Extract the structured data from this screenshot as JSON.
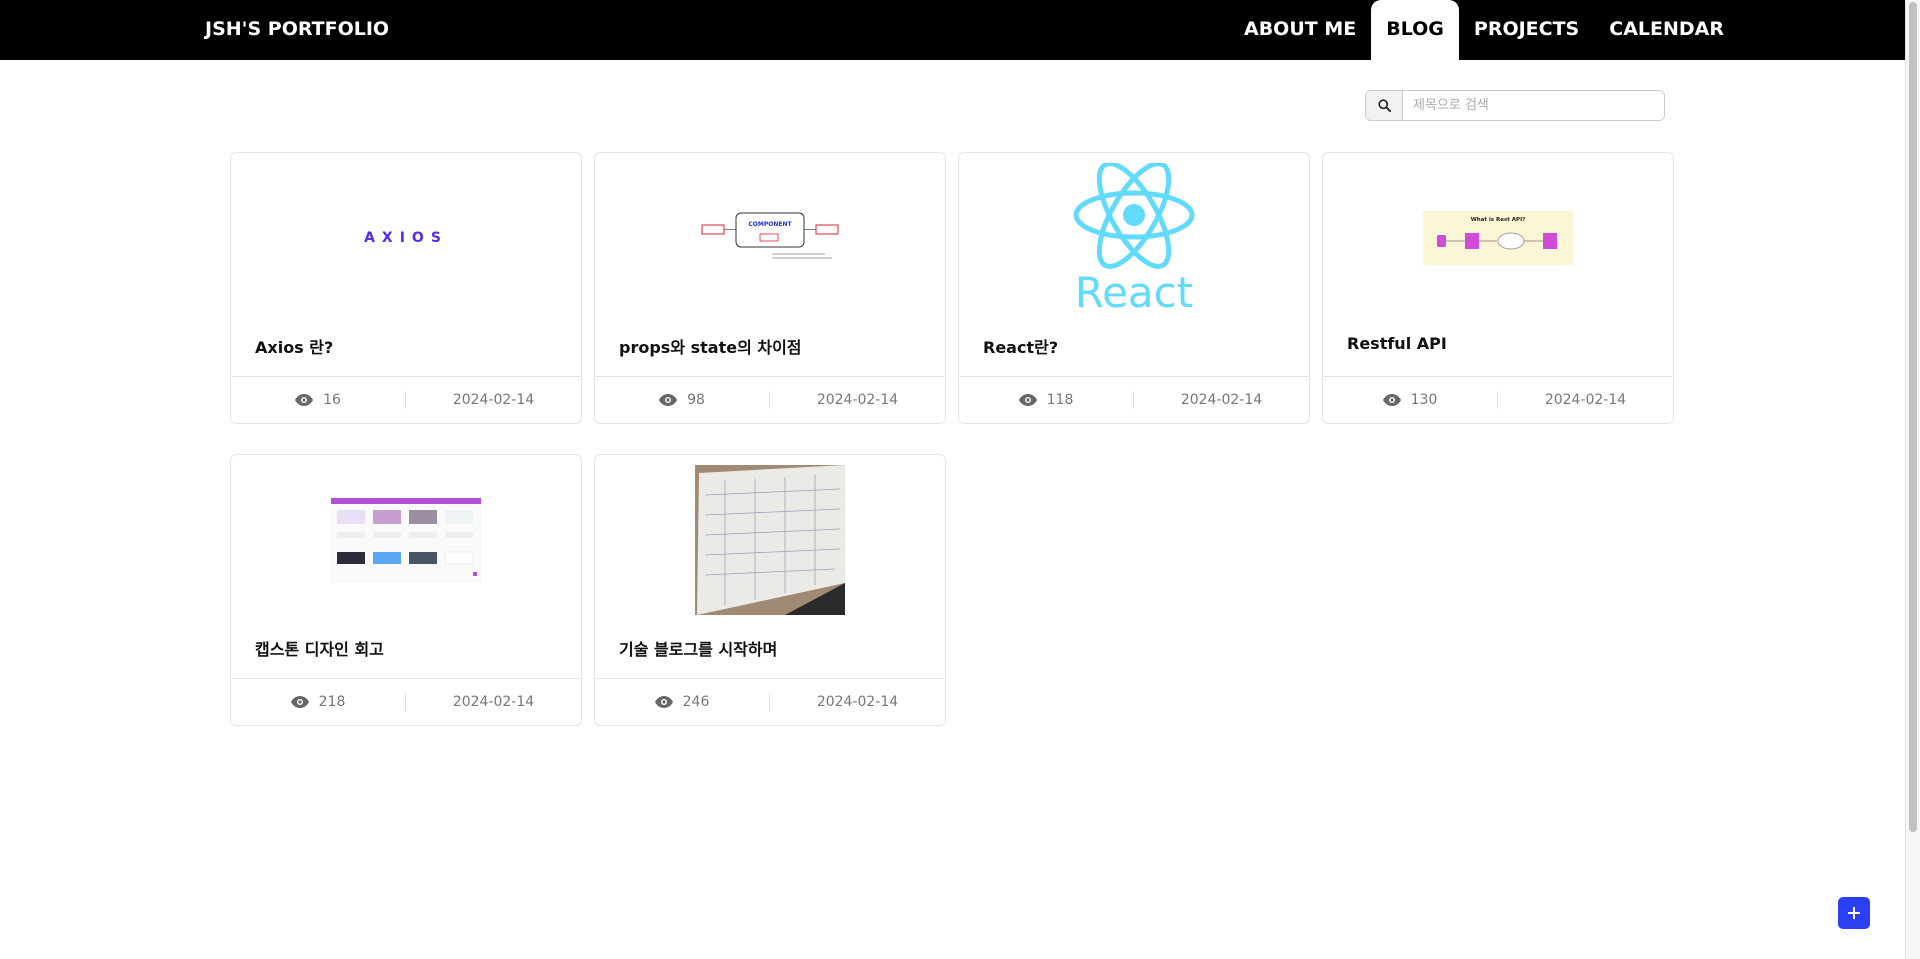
{
  "nav": {
    "brand": "JSH'S PORTFOLIO",
    "items": [
      {
        "label": "ABOUT ME",
        "active": false
      },
      {
        "label": "BLOG",
        "active": true
      },
      {
        "label": "PROJECTS",
        "active": false
      },
      {
        "label": "CALENDAR",
        "active": false
      }
    ]
  },
  "search": {
    "icon": "search-icon",
    "placeholder": "제목으로 검색",
    "value": ""
  },
  "posts": [
    {
      "title": "Axios 란?",
      "views": "16",
      "date": "2024-02-14",
      "thumb": "axios-logo",
      "logo_text": "AXIOS"
    },
    {
      "title": "props와 state의 차이점",
      "views": "98",
      "date": "2024-02-14",
      "thumb": "component-diagram",
      "diagram_label": "COMPONENT"
    },
    {
      "title": "React란?",
      "views": "118",
      "date": "2024-02-14",
      "thumb": "react-logo",
      "logo_text": "React"
    },
    {
      "title": "Restful API",
      "views": "130",
      "date": "2024-02-14",
      "thumb": "rest-api-diagram",
      "diagram_label": "What is Rest API?"
    },
    {
      "title": "캡스톤 디자인 회고",
      "views": "218",
      "date": "2024-02-14",
      "thumb": "design-screenshot"
    },
    {
      "title": "기술 블로그를 시작하며",
      "views": "246",
      "date": "2024-02-14",
      "thumb": "notebook-photo"
    }
  ],
  "fab": {
    "icon": "plus-icon"
  },
  "colors": {
    "navbar": "#000000",
    "fab": "#2b3ff5",
    "axios": "#5a29e4",
    "react": "#61dafb"
  }
}
